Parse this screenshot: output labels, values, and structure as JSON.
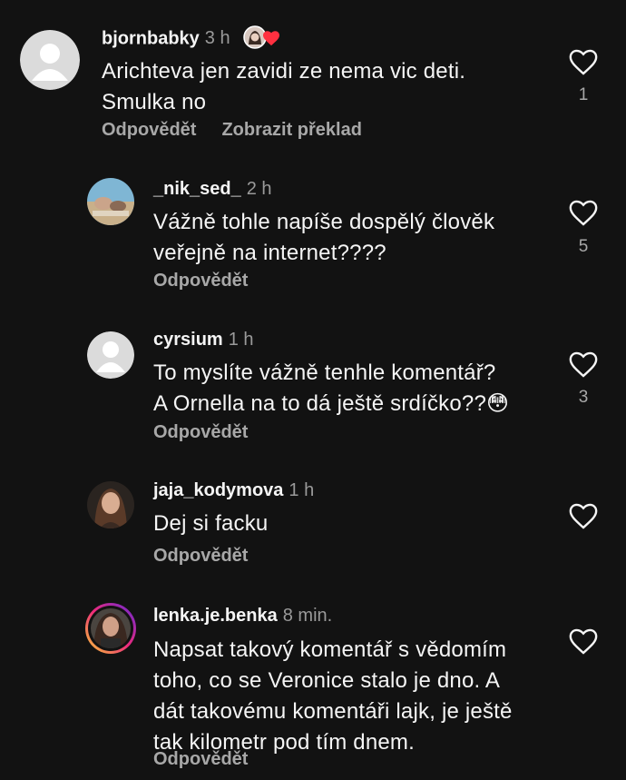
{
  "ui": {
    "reply_label": "Odpovědět",
    "translate_label": "Zobrazit překlad"
  },
  "comments": [
    {
      "username": "bjornbabky",
      "time": "3 h",
      "lines": [
        "Arichteva jen zavidi ze nema vic deti.",
        "Smulka no"
      ],
      "likes": "1",
      "author_liked": true,
      "show_translate": true
    },
    {
      "username": "_nik_sed_",
      "time": "2 h",
      "lines": [
        "Vážně tohle napíše dospělý člověk",
        "veřejně na internet????"
      ],
      "likes": "5"
    },
    {
      "username": "cyrsium",
      "time": "1 h",
      "lines": [
        "To myslíte vážně tenhle komentář?",
        "A Ornella na to dá ještě srdíčko??😳"
      ],
      "likes": "3"
    },
    {
      "username": "jaja_kodymova",
      "time": "1 h",
      "lines": [
        "Dej si facku"
      ],
      "likes": ""
    },
    {
      "username": "lenka.je.benka",
      "time": "8 min.",
      "lines": [
        "Napsat takový komentář s vědomím",
        "toho, co se Veronice stalo je dno. A",
        "dát takovému komentáři lajk, je ještě",
        "tak kilometr pod tím dnem."
      ],
      "likes": ""
    }
  ],
  "colors": {
    "background": "#121212",
    "text_primary": "#f5f5f5",
    "text_secondary": "#a8a8a8",
    "heart_red": "#ff3040",
    "story_ring_start": "#f9ce34",
    "story_ring_end": "#ee2a7b"
  },
  "icons": {
    "like": "heart-outline-icon",
    "author_liked": "heart-filled-icon",
    "default_avatar": "default-avatar-icon"
  }
}
